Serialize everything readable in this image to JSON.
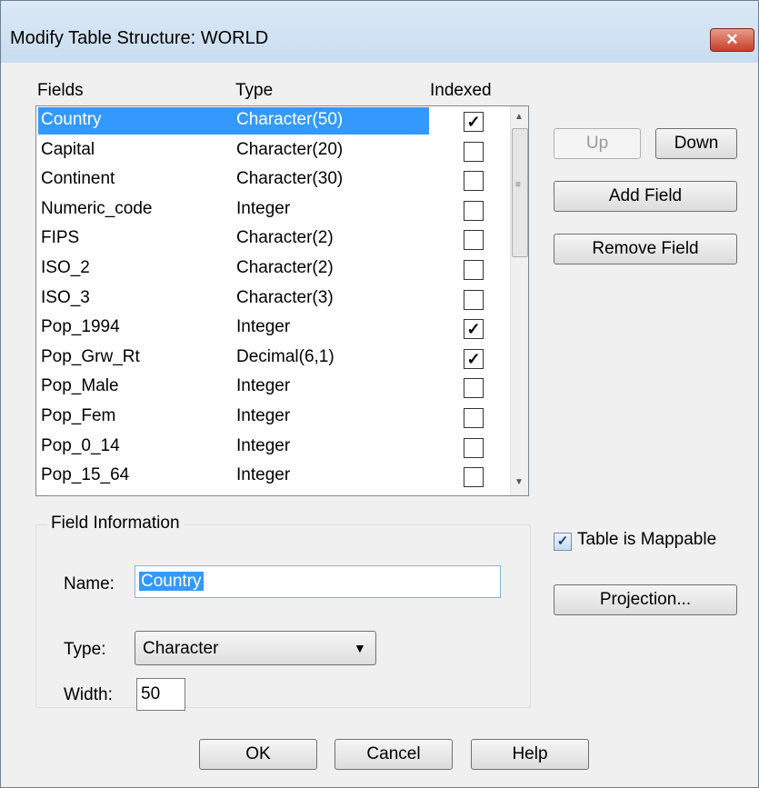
{
  "window": {
    "title": "Modify Table Structure: WORLD",
    "close_label": "✕"
  },
  "headers": {
    "fields": "Fields",
    "type": "Type",
    "indexed": "Indexed"
  },
  "fields": [
    {
      "name": "Country",
      "type": "Character(50)",
      "indexed": true,
      "selected": true
    },
    {
      "name": "Capital",
      "type": "Character(20)",
      "indexed": false
    },
    {
      "name": "Continent",
      "type": "Character(30)",
      "indexed": false
    },
    {
      "name": "Numeric_code",
      "type": "Integer",
      "indexed": false
    },
    {
      "name": "FIPS",
      "type": "Character(2)",
      "indexed": false
    },
    {
      "name": "ISO_2",
      "type": "Character(2)",
      "indexed": false
    },
    {
      "name": "ISO_3",
      "type": "Character(3)",
      "indexed": false
    },
    {
      "name": "Pop_1994",
      "type": "Integer",
      "indexed": true
    },
    {
      "name": "Pop_Grw_Rt",
      "type": "Decimal(6,1)",
      "indexed": true
    },
    {
      "name": "Pop_Male",
      "type": "Integer",
      "indexed": false
    },
    {
      "name": "Pop_Fem",
      "type": "Integer",
      "indexed": false
    },
    {
      "name": "Pop_0_14",
      "type": "Integer",
      "indexed": false
    },
    {
      "name": "Pop_15_64",
      "type": "Integer",
      "indexed": false
    }
  ],
  "buttons": {
    "up": "Up",
    "down": "Down",
    "add_field": "Add Field",
    "remove_field": "Remove Field",
    "projection": "Projection...",
    "ok": "OK",
    "cancel": "Cancel",
    "help": "Help"
  },
  "field_info": {
    "group_label": "Field Information",
    "name_label": "Name:",
    "name_value": "Country",
    "type_label": "Type:",
    "type_value": "Character",
    "width_label": "Width:",
    "width_value": "50"
  },
  "mappable": {
    "label": "Table is Mappable",
    "checked": true
  }
}
